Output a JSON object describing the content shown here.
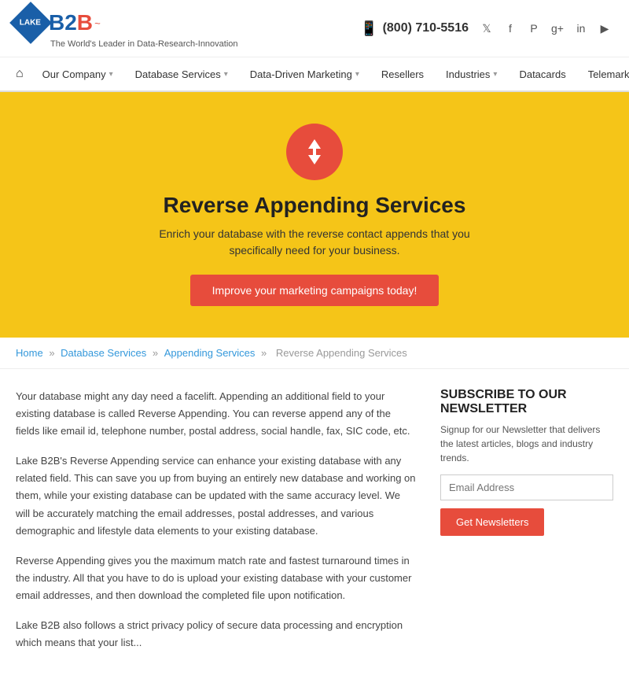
{
  "header": {
    "logo_text": "LAKE",
    "logo_b2b": "B2",
    "logo_b2b_accent": "B",
    "tagline": "The World's Leader in Data-Research-Innovation",
    "phone": "(800) 710-5516",
    "social": [
      "twitter",
      "facebook",
      "pinterest",
      "google-plus",
      "linkedin",
      "youtube"
    ]
  },
  "nav": {
    "home_icon": "⌂",
    "items": [
      {
        "label": "Our Company",
        "has_arrow": true
      },
      {
        "label": "Database Services",
        "has_arrow": true
      },
      {
        "label": "Data-Driven Marketing",
        "has_arrow": true
      },
      {
        "label": "Resellers",
        "has_arrow": false
      },
      {
        "label": "Industries",
        "has_arrow": true
      },
      {
        "label": "Datacards",
        "has_arrow": false
      },
      {
        "label": "Telemarketing",
        "has_arrow": false
      }
    ]
  },
  "hero": {
    "title": "Reverse Appending Services",
    "subtitle": "Enrich your database with the reverse contact appends that you specifically need for your business.",
    "button_label": "Improve your marketing campaigns today!"
  },
  "breadcrumb": {
    "items": [
      "Home",
      "Database Services",
      "Appending Services",
      "Reverse Appending Services"
    ],
    "separator": "»"
  },
  "main": {
    "paragraphs": [
      "Your database might any day need a facelift. Appending an additional field to your existing database is called Reverse Appending. You can reverse append any of the fields like email id, telephone number, postal address, social handle, fax, SIC code, etc.",
      "Lake B2B's Reverse Appending service can enhance your existing database with any related field. This can save you up from buying an entirely new database and working on them, while your existing database can be updated with the same accuracy level. We will be accurately matching the email addresses, postal addresses, and various demographic and lifestyle data elements to your existing database.",
      "Reverse Appending gives you the maximum match rate and fastest turnaround times in the industry. All that you have to do is upload your existing database with your customer email addresses, and then download the completed file upon notification.",
      "Lake B2B also follows a strict privacy policy of secure data processing and encryption which means that your list..."
    ]
  },
  "sidebar": {
    "subscribe_title": "SUBSCRIBE TO OUR NEWSLETTER",
    "subscribe_text": "Signup for our Newsletter that delivers the latest articles, blogs and industry trends.",
    "email_placeholder": "Email Address",
    "button_label": "Get Newsletters"
  }
}
